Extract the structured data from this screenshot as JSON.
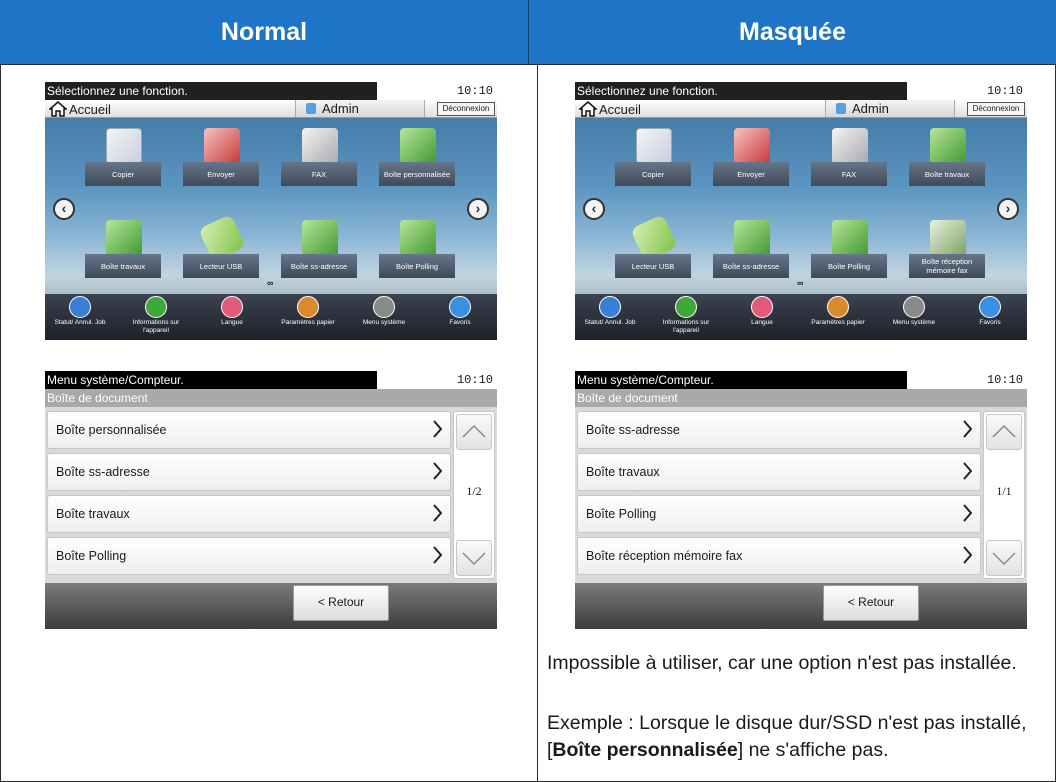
{
  "header": {
    "normal": "Normal",
    "masked": "Masquée"
  },
  "home": {
    "status_message": "Sélectionnez une fonction.",
    "time": "10:10",
    "home_label": "Accueil",
    "admin_label": "Admin",
    "logout_label": "Déconnexion",
    "page_dots": "∞"
  },
  "normal_home": {
    "row1": [
      "Copier",
      "Envoyer",
      "FAX",
      "Boîte personnalisée"
    ],
    "row2": [
      "Boîte travaux",
      "Lecteur USB",
      "Boîte ss-adresse",
      "Boîte Polling"
    ]
  },
  "masked_home": {
    "row1": [
      "Copier",
      "Envoyer",
      "FAX",
      "Boîte travaux"
    ],
    "row2": [
      "Lecteur USB",
      "Boîte ss-adresse",
      "Boîte Polling",
      "Boîte réception mémoire fax"
    ]
  },
  "bottom_bar": [
    {
      "label": "Statut/ Annul. Job",
      "icon": "status-icon",
      "color": "#3a7fd6"
    },
    {
      "label": "Informations sur l'appareil",
      "icon": "device-info-icon",
      "color": "#3fa83a"
    },
    {
      "label": "Langue",
      "icon": "language-icon",
      "color": "#e05a7a"
    },
    {
      "label": "Paramètres papier",
      "icon": "paper-settings-icon",
      "color": "#d98a2f"
    },
    {
      "label": "Menu système",
      "icon": "system-menu-icon",
      "color": "#8a8a8a"
    },
    {
      "label": "Favoris",
      "icon": "favorites-icon",
      "color": "#3a8fe0"
    }
  ],
  "menu": {
    "status_message": "Menu système/Compteur.",
    "time": "10:10",
    "breadcrumb": "Boîte de document",
    "back_label": "< Retour"
  },
  "normal_menu": {
    "items": [
      "Boîte personnalisée",
      "Boîte ss-adresse",
      "Boîte travaux",
      "Boîte Polling"
    ],
    "page": "1/2"
  },
  "masked_menu": {
    "items": [
      "Boîte ss-adresse",
      "Boîte travaux",
      "Boîte Polling",
      "Boîte réception mémoire fax"
    ],
    "page": "1/1"
  },
  "note": {
    "line1": "Impossible à utiliser, car une option n'est pas installée.",
    "example_prefix": "Exemple : Lorsque le disque dur/SSD n'est pas installé, [",
    "example_bold": "Boîte personnalisée",
    "example_suffix": "] ne s'affiche pas."
  },
  "colors": {
    "header_blue": "#1e74c6"
  }
}
